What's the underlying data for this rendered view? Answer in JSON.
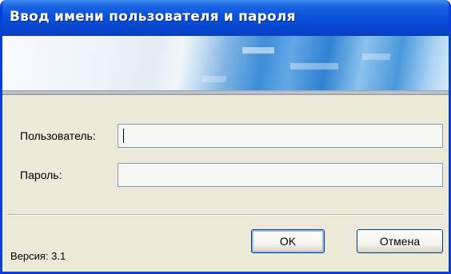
{
  "window": {
    "title": "Ввод имени пользователя и пароля"
  },
  "form": {
    "username_label": "Пользователь:",
    "username_value": "",
    "password_label": "Пароль:",
    "password_value": ""
  },
  "buttons": {
    "ok_label": "OK",
    "cancel_label": "Отмена"
  },
  "footer": {
    "version_text": "Версия: 3.1"
  },
  "colors": {
    "titlebar": "#0a4fd8",
    "window_bg": "#ece9d8",
    "field_border": "#7f9db9"
  }
}
